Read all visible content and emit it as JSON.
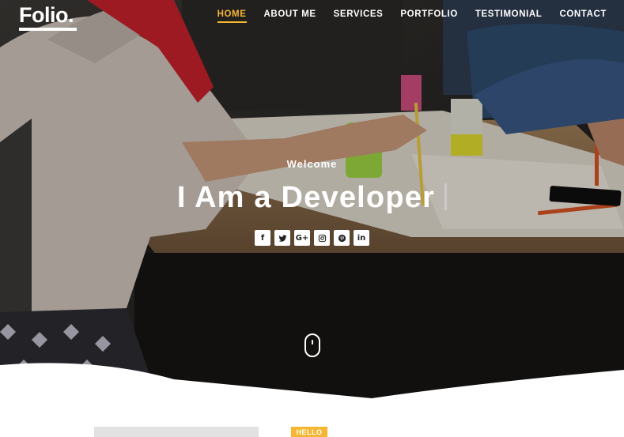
{
  "brand": {
    "logo": "Folio."
  },
  "nav": {
    "items": [
      {
        "label": "HOME"
      },
      {
        "label": "ABOUT ME"
      },
      {
        "label": "SERVICES"
      },
      {
        "label": "PORTFOLIO"
      },
      {
        "label": "TESTIMONIAL"
      },
      {
        "label": "CONTACT"
      }
    ],
    "active_index": 0
  },
  "hero": {
    "welcome": "Welcome",
    "headline": "I Am a Developer",
    "socials": [
      {
        "icon": "facebook-icon",
        "glyph": "f"
      },
      {
        "icon": "twitter-icon",
        "glyph": ""
      },
      {
        "icon": "google-plus-icon",
        "glyph": "G+"
      },
      {
        "icon": "instagram-icon",
        "glyph": ""
      },
      {
        "icon": "pinterest-icon",
        "glyph": ""
      },
      {
        "icon": "linkedin-icon",
        "glyph": "in"
      }
    ],
    "scroll_icon": "mouse-scroll-icon"
  },
  "about": {
    "badge": "HELLO"
  },
  "colors": {
    "accent": "#f5b731",
    "text_light": "#ffffff",
    "dark": "#1d1c1b"
  }
}
